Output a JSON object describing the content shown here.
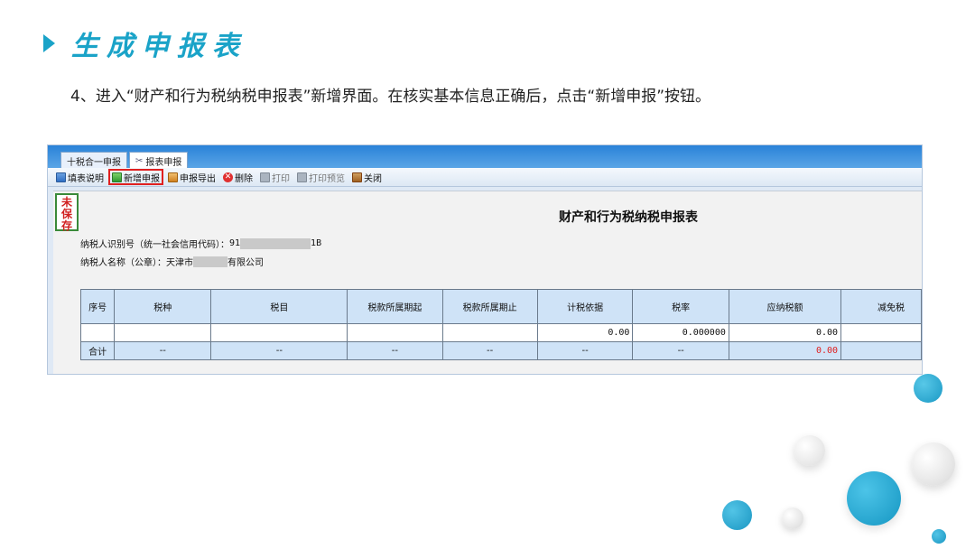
{
  "slide": {
    "title": "生成申报表",
    "instruction": "4、进入“财产和行为税纳税申报表”新增界面。在核实基本信息正确后，点击“新增申报”按钮。"
  },
  "app": {
    "tabs": [
      {
        "label": "十税合一申报"
      },
      {
        "label": "报表申报"
      }
    ],
    "toolbar": {
      "fill_guide": "填表说明",
      "new_declaration": "新增申报",
      "export": "申报导出",
      "delete": "删除",
      "print": "打印",
      "print_preview": "打印预览",
      "close": "关闭"
    },
    "stamp": "未保存",
    "form_title": "财产和行为税纳税申报表",
    "taxpayer_id_label": "纳税人识别号（统一社会信用代码）：",
    "taxpayer_id_prefix": "91",
    "taxpayer_id_suffix": "1B",
    "taxpayer_name_label": "纳税人名称（公章）：",
    "taxpayer_name_prefix": "天津市",
    "taxpayer_name_suffix": "有限公司",
    "table": {
      "headers": [
        "序号",
        "税种",
        "税目",
        "税款所属期起",
        "税款所属期止",
        "计税依据",
        "税率",
        "应纳税额",
        "减免税"
      ],
      "row1": [
        "",
        "",
        "",
        "",
        "",
        "0.00",
        "0.000000",
        "0.00",
        ""
      ],
      "total": [
        "合计",
        "--",
        "--",
        "--",
        "--",
        "--",
        "--",
        "0.00",
        ""
      ]
    }
  },
  "colors": {
    "accent": "#1aa3c8",
    "highlight": "#e02020"
  }
}
